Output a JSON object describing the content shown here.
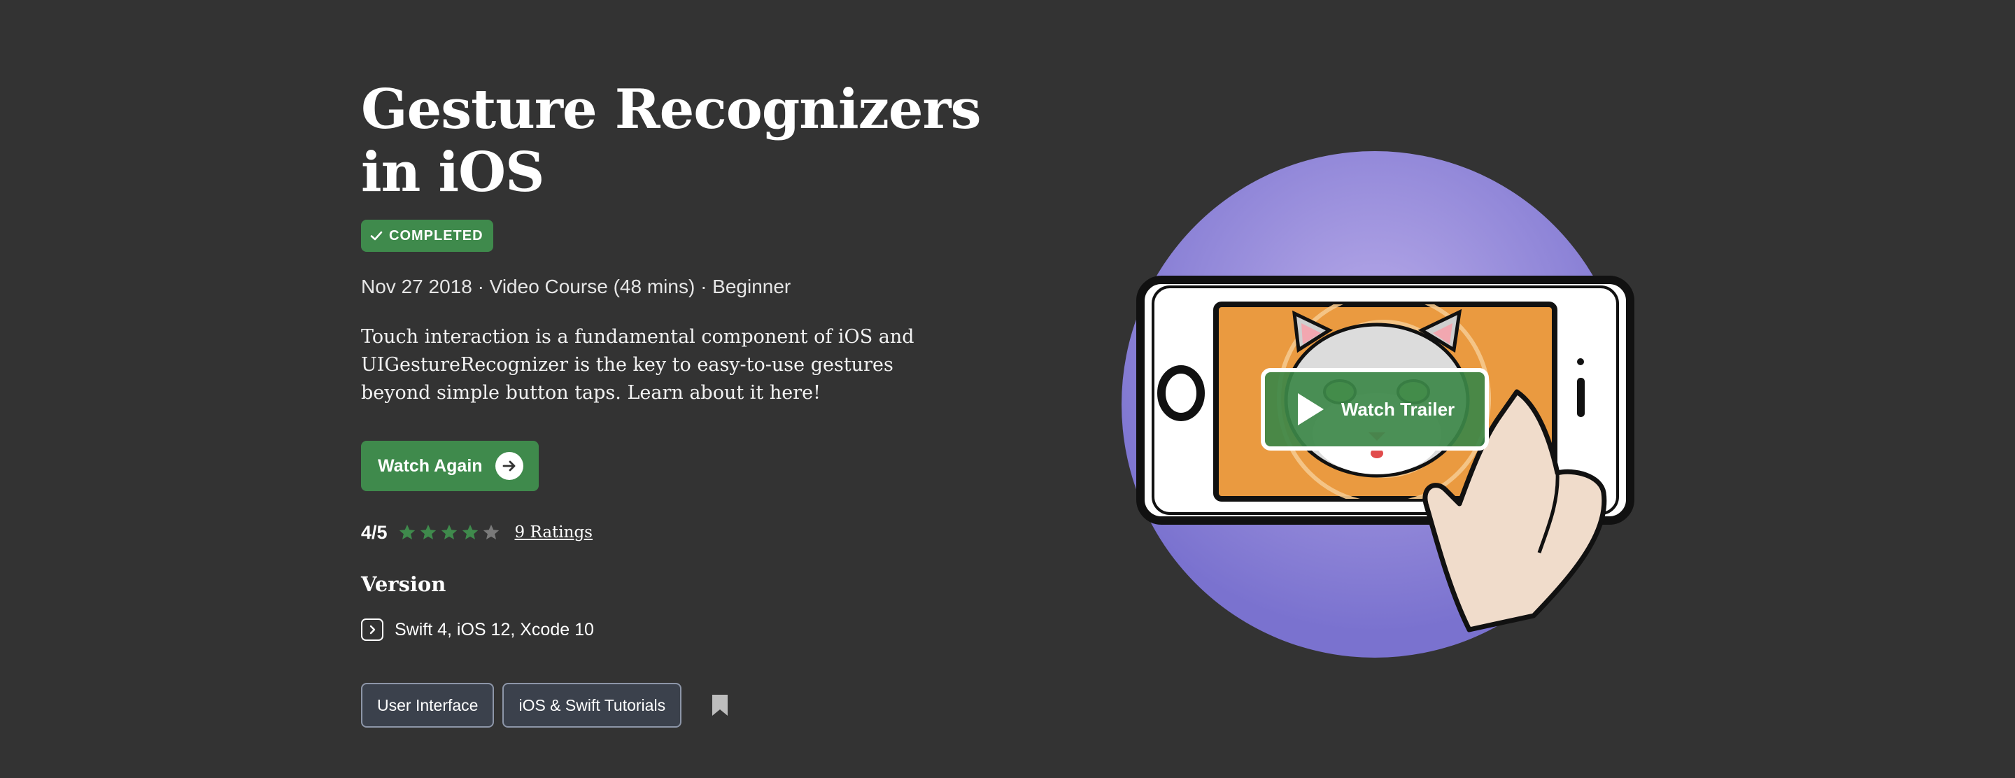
{
  "course": {
    "title": "Gesture Recognizers in iOS",
    "status_badge": "COMPLETED",
    "meta": "Nov 27 2018 · Video Course (48 mins) · Beginner",
    "description": "Touch interaction is a fundamental component of iOS and UIGestureRecognizer is the key to easy-to-use gestures beyond simple button taps. Learn about it here!"
  },
  "actions": {
    "watch_again_label": "Watch Again",
    "watch_trailer_label": "Watch Trailer"
  },
  "rating": {
    "score": "4/5",
    "stars_filled": 4,
    "stars_total": 5,
    "ratings_link": "9 Ratings"
  },
  "version": {
    "heading": "Version",
    "value": "Swift 4, iOS 12, Xcode 10"
  },
  "tags": [
    "User Interface",
    "iOS & Swift Tutorials"
  ],
  "icons": {
    "badge": "check-icon",
    "watch_again": "arrow-right-icon",
    "version": "chevron-right-icon",
    "bookmark": "bookmark-icon",
    "trailer": "play-icon"
  },
  "colors": {
    "background": "#333333",
    "accent_green": "#3f8a4c",
    "star_filled": "#3f8a4c",
    "star_empty": "#7a7a7a",
    "tag_border": "#8d96a8",
    "artwork_circle": "#8e86d8",
    "phone_screen": "#ea9a40"
  }
}
